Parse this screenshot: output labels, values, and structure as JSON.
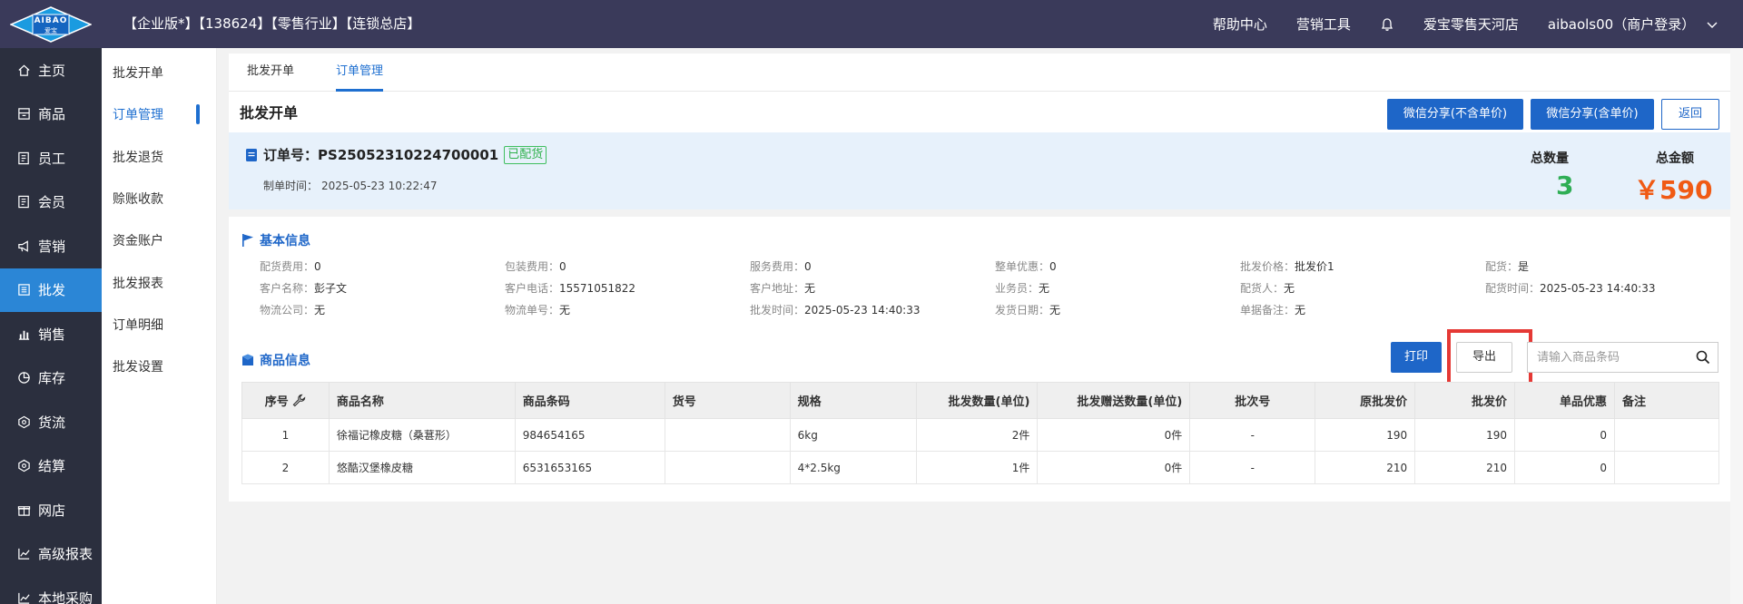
{
  "header": {
    "logo_text": "AIBAO",
    "logo_sub": "爱宝",
    "title": "【企业版*】【138624】【零售行业】【连锁总店】",
    "links": [
      "帮助中心",
      "营销工具"
    ],
    "store": "爱宝零售天河店",
    "user": "aibaols00（商户登录）"
  },
  "sidebar": {
    "items": [
      {
        "label": "主页",
        "icon": "home-icon"
      },
      {
        "label": "商品",
        "icon": "box-icon"
      },
      {
        "label": "员工",
        "icon": "staff-icon"
      },
      {
        "label": "会员",
        "icon": "member-icon"
      },
      {
        "label": "营销",
        "icon": "megaphone-icon"
      },
      {
        "label": "批发",
        "icon": "wholesale-icon"
      },
      {
        "label": "销售",
        "icon": "bar-chart-icon"
      },
      {
        "label": "库存",
        "icon": "pie-icon"
      },
      {
        "label": "货流",
        "icon": "flow-icon"
      },
      {
        "label": "结算",
        "icon": "settle-icon"
      },
      {
        "label": "网店",
        "icon": "gift-icon"
      },
      {
        "label": "高级报表",
        "icon": "line-chart-icon"
      },
      {
        "label": "本地采购",
        "icon": "line-chart-icon"
      }
    ],
    "active_index": 5
  },
  "subnav": {
    "items": [
      "批发开单",
      "订单管理",
      "批发退货",
      "赊账收款",
      "资金账户",
      "批发报表",
      "订单明细",
      "批发设置"
    ],
    "active_index": 1
  },
  "tabs": [
    "批发开单",
    "订单管理"
  ],
  "page": {
    "title": "批发开单",
    "btn_share_no_price": "微信分享(不含单价)",
    "btn_share_price": "微信分享(含单价)",
    "btn_back": "返回"
  },
  "order": {
    "label": "订单号：",
    "number": "PS25052310224700001",
    "status": "已配货",
    "time_label": "制单时间：",
    "time": "2025-05-23 10:22:47",
    "qty_label": "总数量",
    "qty": "3",
    "amount_label": "总金额",
    "amount": "￥590"
  },
  "basic": {
    "title": "基本信息",
    "rows": [
      [
        {
          "k": "配货费用：",
          "v": "0"
        },
        {
          "k": "包装费用：",
          "v": "0"
        },
        {
          "k": "服务费用：",
          "v": "0"
        },
        {
          "k": "整单优惠：",
          "v": "0"
        },
        {
          "k": "批发价格：",
          "v": "批发价1"
        },
        {
          "k": "配货：",
          "v": "是"
        }
      ],
      [
        {
          "k": "客户名称：",
          "v": "彭子文"
        },
        {
          "k": "客户电话：",
          "v": "15571051822"
        },
        {
          "k": "客户地址：",
          "v": "无"
        },
        {
          "k": "业务员：",
          "v": "无"
        },
        {
          "k": "配货人：",
          "v": "无"
        },
        {
          "k": "配货时间：",
          "v": "2025-05-23 14:40:33"
        }
      ],
      [
        {
          "k": "物流公司：",
          "v": "无"
        },
        {
          "k": "物流单号：",
          "v": "无"
        },
        {
          "k": "批发时间：",
          "v": "2025-05-23 14:40:33"
        },
        {
          "k": "发货日期：",
          "v": "无"
        },
        {
          "k": "单据备注：",
          "v": "无"
        }
      ]
    ]
  },
  "goods": {
    "title": "商品信息",
    "btn_print": "打印",
    "btn_export": "导出",
    "search_placeholder": "请输入商品条码",
    "columns": [
      "序号",
      "商品名称",
      "商品条码",
      "货号",
      "规格",
      "批发数量(单位)",
      "批发赠送数量(单位)",
      "批次号",
      "原批发价",
      "批发价",
      "单品优惠",
      "备注"
    ],
    "rows": [
      [
        "1",
        "徐福记橡皮糖（桑葚形）",
        "984654165",
        "",
        "6kg",
        "2件",
        "0件",
        "-",
        "190",
        "190",
        "0",
        ""
      ],
      [
        "2",
        "悠酷汉堡橡皮糖",
        "6531653165",
        "",
        "4*2.5kg",
        "1件",
        "0件",
        "-",
        "210",
        "210",
        "0",
        ""
      ]
    ]
  }
}
